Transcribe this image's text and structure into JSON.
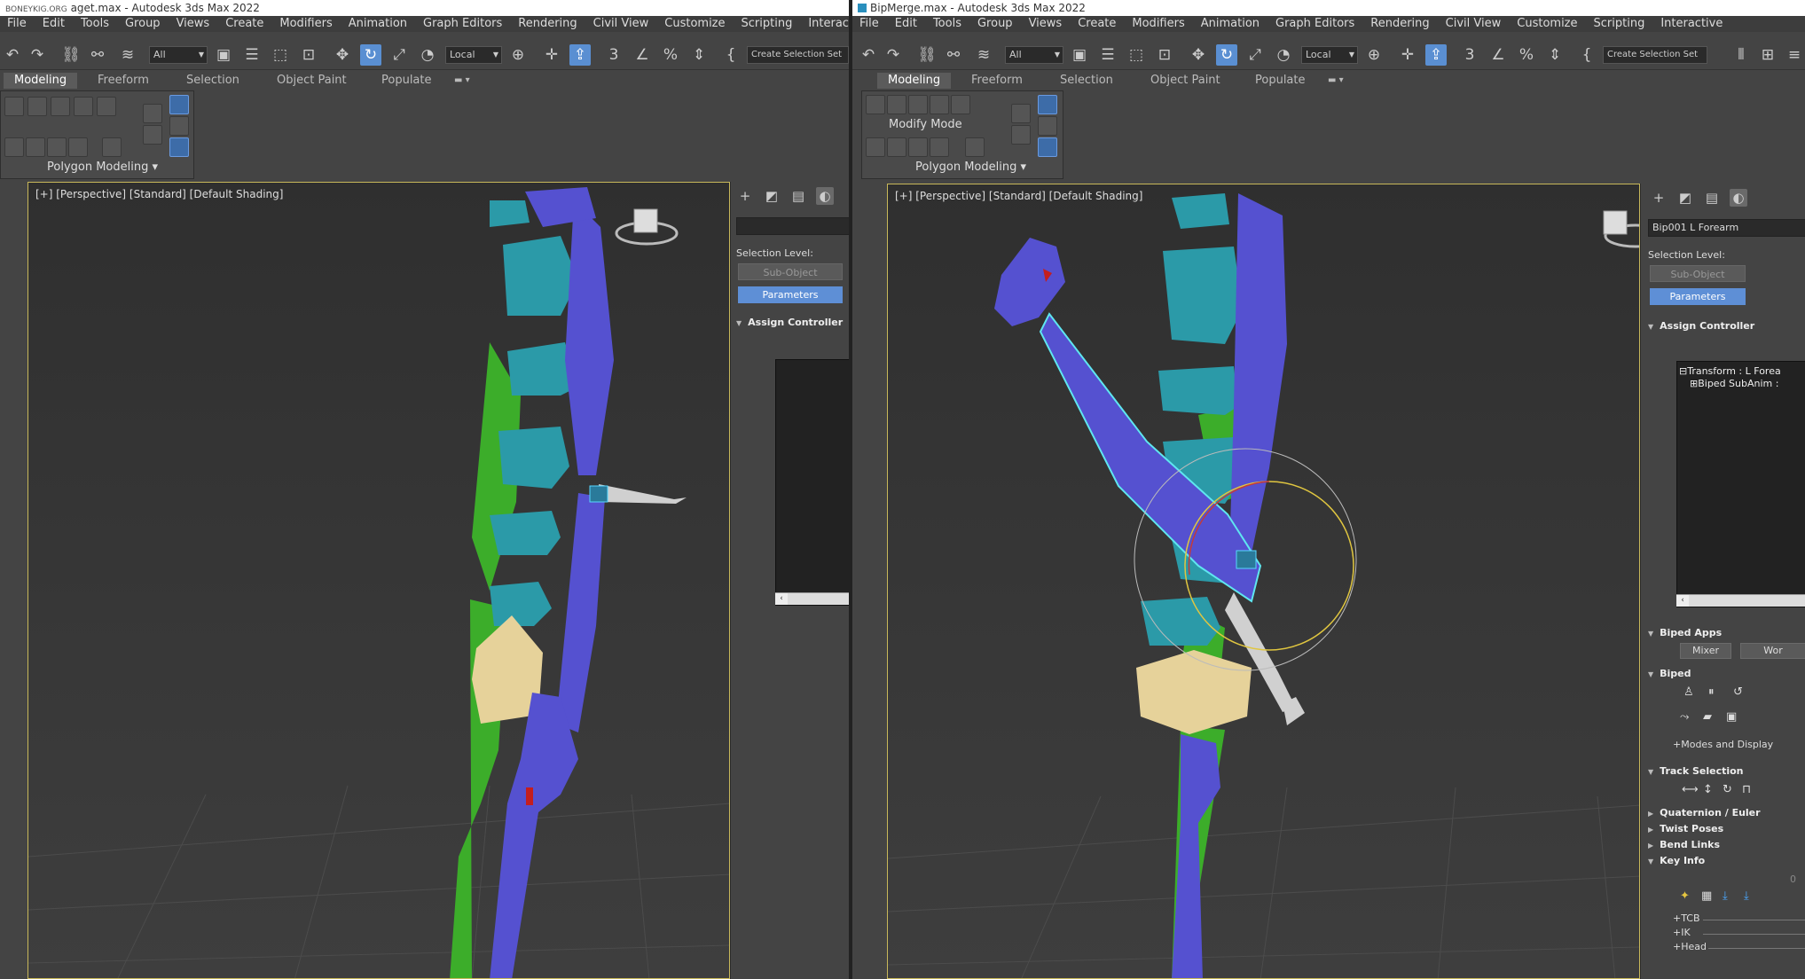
{
  "left": {
    "title": "aget.max - Autodesk 3ds Max 2022",
    "title_prefix": "BONEYKIG.ORG",
    "menu": [
      "File",
      "Edit",
      "Tools",
      "Group",
      "Views",
      "Create",
      "Modifiers",
      "Animation",
      "Graph Editors",
      "Rendering",
      "Civil View",
      "Customize",
      "Scripting",
      "Interactive"
    ],
    "filter_dropdown": "All",
    "coord_dropdown": "Local",
    "selection_set_dropdown": "Create Selection Set",
    "ribbon_tabs": [
      "Modeling",
      "Freeform",
      "Selection",
      "Object Paint",
      "Populate"
    ],
    "ribbon_panel_label": "Polygon Modeling",
    "viewport_label": "[+] [Perspective] [Standard] [Default Shading]",
    "command_panel": {
      "selection_level": "Selection Level:",
      "sub_object": "Sub-Object",
      "parameters": "Parameters",
      "assign_controller": "Assign Controller"
    }
  },
  "right": {
    "title": "BipMerge.max - Autodesk 3ds Max 2022",
    "menu": [
      "File",
      "Edit",
      "Tools",
      "Group",
      "Views",
      "Create",
      "Modifiers",
      "Animation",
      "Graph Editors",
      "Rendering",
      "Civil View",
      "Customize",
      "Scripting",
      "Interactive"
    ],
    "filter_dropdown": "All",
    "coord_dropdown": "Local",
    "selection_set_dropdown": "Create Selection Set",
    "ribbon_tabs": [
      "Modeling",
      "Freeform",
      "Selection",
      "Object Paint",
      "Populate"
    ],
    "ribbon_mode_label": "Modify Mode",
    "ribbon_panel_label": "Polygon Modeling",
    "viewport_label": "[+] [Perspective] [Standard] [Default Shading]",
    "command_panel": {
      "object_name": "Bip001 L Forearm",
      "selection_level": "Selection Level:",
      "sub_object": "Sub-Object",
      "parameters": "Parameters",
      "assign_controller": "Assign Controller",
      "tree_items": [
        "Transform : L Forea",
        "Biped SubAnim :"
      ],
      "biped_apps": "Biped Apps",
      "mixer": "Mixer",
      "workbench": "Wor",
      "biped": "Biped",
      "modes_and_display": "Modes and Display",
      "track_selection": "Track Selection",
      "quaternion_euler": "Quaternion / Euler",
      "twist_poses": "Twist Poses",
      "bend_links": "Bend Links",
      "key_info": "Key Info",
      "key_value": "0",
      "tcb": "TCB",
      "ik": "IK",
      "head": "Head"
    }
  },
  "colors": {
    "biped_blue": "#5551d0",
    "biped_teal": "#2b9aa8",
    "biped_green": "#3cad2a",
    "pelvis_tan": "#e6d29a",
    "selection_cyan": "#5fe6f0",
    "active_button_blue": "#5e8fd6",
    "viewport_border": "#c8b85a"
  }
}
